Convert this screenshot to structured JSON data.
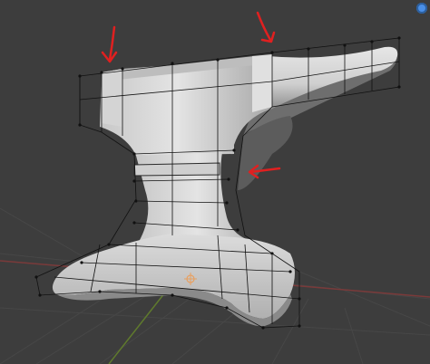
{
  "viewport": {
    "background": "#3d3d3d",
    "grid_color": "#474747",
    "x_axis_color": "#7a3a3a",
    "y_axis_color": "#5f7a2d",
    "mesh_color": "#d8d8d8",
    "wire_color": "#111111",
    "annotation_color": "#e02020"
  },
  "objects": [
    {
      "name": "anvil-mesh",
      "type": "mesh",
      "shading": "solid",
      "overlay": "wireframe-cage"
    }
  ],
  "annotations": [
    {
      "name": "arrow-left-top",
      "direction": "down"
    },
    {
      "name": "arrow-right-top",
      "direction": "down-right"
    },
    {
      "name": "arrow-waist",
      "direction": "left"
    }
  ],
  "gizmo": {
    "icon": "navigation-gizmo-icon",
    "color": "#4a8fe7"
  },
  "origin": {
    "icon": "object-origin-icon",
    "color": "#e8a060"
  }
}
